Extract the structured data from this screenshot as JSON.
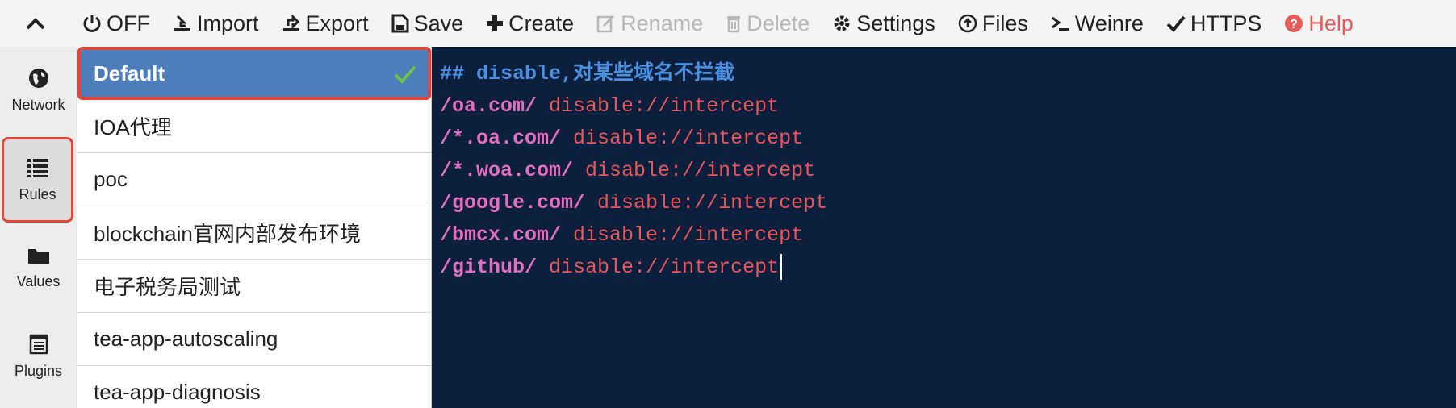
{
  "toolbar": {
    "items": [
      {
        "name": "off",
        "label": "OFF",
        "icon": "power-icon",
        "disabled": false
      },
      {
        "name": "import",
        "label": "Import",
        "icon": "import-icon",
        "disabled": false
      },
      {
        "name": "export",
        "label": "Export",
        "icon": "export-icon",
        "disabled": false
      },
      {
        "name": "save",
        "label": "Save",
        "icon": "save-icon",
        "disabled": false
      },
      {
        "name": "create",
        "label": "Create",
        "icon": "plus-icon",
        "disabled": false
      },
      {
        "name": "rename",
        "label": "Rename",
        "icon": "edit-icon",
        "disabled": true
      },
      {
        "name": "delete",
        "label": "Delete",
        "icon": "trash-icon",
        "disabled": true
      },
      {
        "name": "settings",
        "label": "Settings",
        "icon": "gear-icon",
        "disabled": false
      },
      {
        "name": "files",
        "label": "Files",
        "icon": "upload-circle-icon",
        "disabled": false
      },
      {
        "name": "weinre",
        "label": "Weinre",
        "icon": "terminal-icon",
        "disabled": false
      },
      {
        "name": "https",
        "label": "HTTPS",
        "icon": "check-icon",
        "disabled": false
      },
      {
        "name": "help",
        "label": "Help",
        "icon": "question-icon",
        "disabled": false
      }
    ]
  },
  "nav": {
    "items": [
      {
        "name": "network",
        "label": "Network",
        "icon": "globe-icon"
      },
      {
        "name": "rules",
        "label": "Rules",
        "icon": "list-icon",
        "active": true
      },
      {
        "name": "values",
        "label": "Values",
        "icon": "folder-icon"
      },
      {
        "name": "plugins",
        "label": "Plugins",
        "icon": "plugin-icon"
      }
    ]
  },
  "rules": {
    "items": [
      {
        "label": "Default",
        "active": true
      },
      {
        "label": "IOA代理"
      },
      {
        "label": "poc"
      },
      {
        "label": "blockchain官网内部发布环境"
      },
      {
        "label": "电子税务局测试"
      },
      {
        "label": "tea-app-autoscaling"
      },
      {
        "label": "tea-app-diagnosis"
      }
    ]
  },
  "editor": {
    "comment": "## disable,对某些域名不拦截",
    "lines": [
      {
        "pattern": "/oa.com/",
        "op": "disable://intercept"
      },
      {
        "pattern": "/*.oa.com/",
        "op": "disable://intercept"
      },
      {
        "pattern": "/*.woa.com/",
        "op": "disable://intercept"
      },
      {
        "pattern": "/google.com/",
        "op": "disable://intercept"
      },
      {
        "pattern": "/bmcx.com/",
        "op": "disable://intercept"
      },
      {
        "pattern": "/github/",
        "op": "disable://intercept"
      }
    ]
  },
  "colors": {
    "accent": "#4d7dbb",
    "highlight": "#e2463a",
    "editor_bg": "#0c1f3d",
    "help": "#e85d59"
  }
}
